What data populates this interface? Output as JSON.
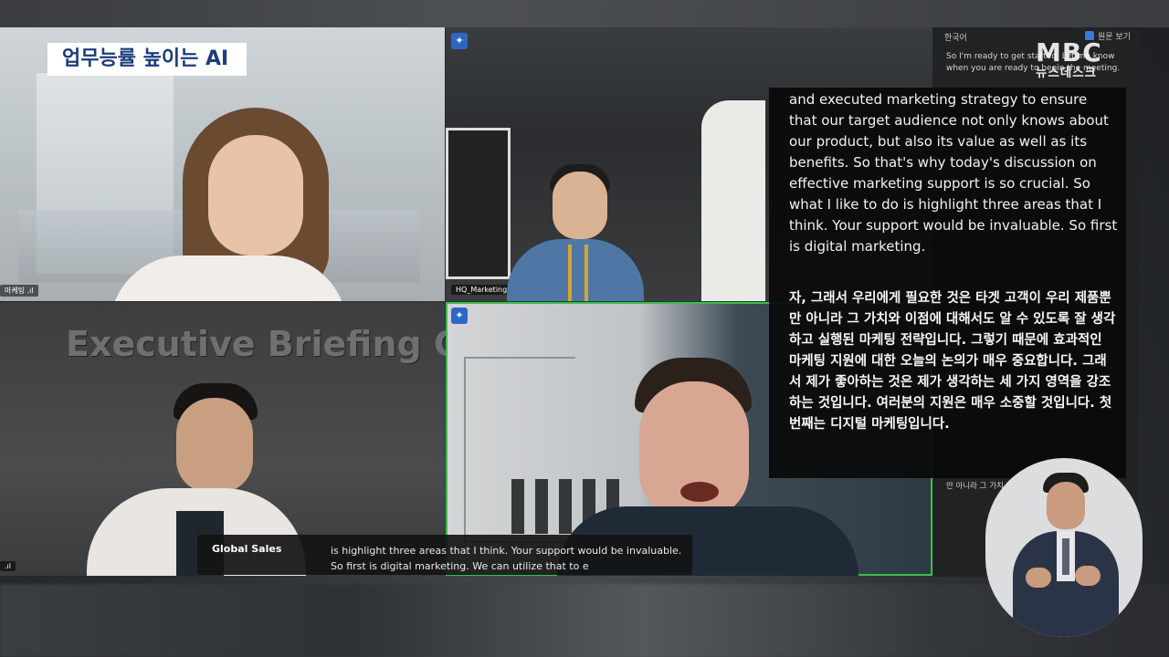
{
  "news": {
    "caption": "업무능률 높이는 AI",
    "logo_main": "MBC",
    "logo_sub": "뉴스데스크"
  },
  "meeting": {
    "tiles": [
      {
        "name_tag": "마케팅 .ıl"
      },
      {
        "name_tag": "HQ_Marketing .ıl"
      },
      {
        "name_tag": ".ıl"
      },
      {
        "name_tag": ""
      }
    ],
    "background_sign": "Executive Briefing Cente",
    "pin_icon": "pin-icon"
  },
  "sidebar": {
    "language": "한국어",
    "original_toggle": "원문 보기",
    "english_lines": "So I'm ready to get started. Let me know when you are ready to begin the meeting.",
    "korean_lines": "만 아니라 그 가치 / 각하고 실행된 / 그렇기 때문에 / 가 매우 중요 / 그래서 제가 / 강조하는 것 / 여러분의 지 / 첫 번째는 디"
  },
  "translation_overlay": {
    "english": "and executed marketing strategy to ensure that our target audience not only knows about our product, but also its value as well as its benefits. So that's why today's discussion on effective marketing support is so crucial. So what I like to do is highlight three areas that I think. Your support would be invaluable. So first is digital marketing.",
    "korean": "자, 그래서 우리에게 필요한 것은 타겟 고객이 우리 제품뿐만 아니라 그 가치와 이점에 대해서도 알 수 있도록 잘 생각하고 실행된 마케팅 전략입니다. 그렇기 때문에 효과적인 마케팅 지원에 대한 오늘의 논의가 매우 중요합니다. 그래서 제가 좋아하는 것은 제가 생각하는 세 가지 영역을 강조하는 것입니다. 여러분의 지원은 매우 소중할 것입니다. 첫 번째는 디지털 마케팅입니다."
  },
  "caption_strip": {
    "speaker": "Global Sales",
    "text": "is highlight three areas that I think. Your support would be invaluable. So first is digital marketing. We can utilize that to e"
  },
  "colors": {
    "active_speaker_border": "#37c04a",
    "pin_blue": "#2c67c6",
    "caption_navy": "#1c3c7a"
  }
}
